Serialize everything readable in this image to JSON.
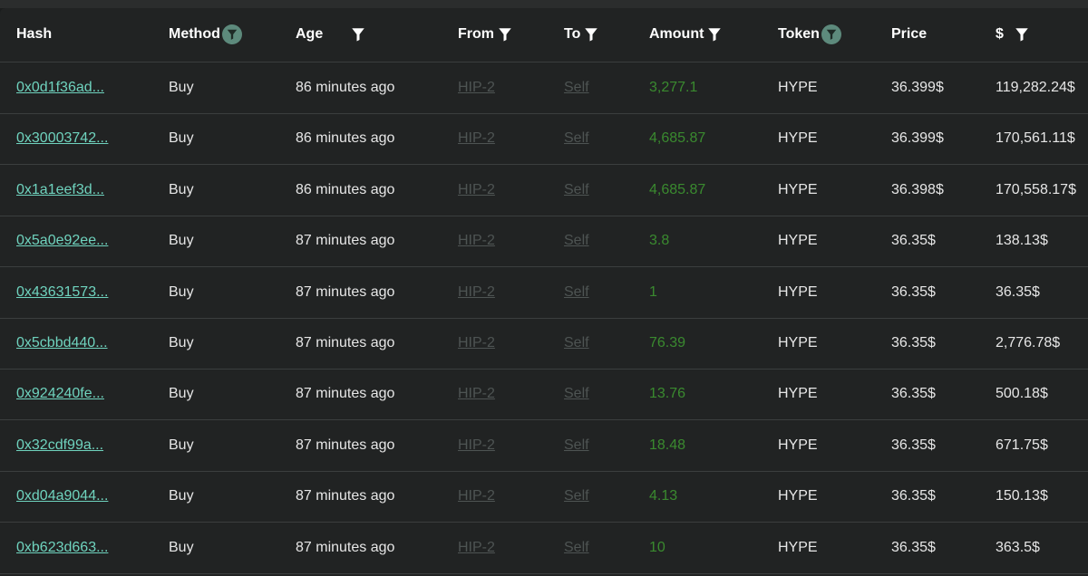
{
  "columns": [
    {
      "key": "hash",
      "label": "Hash",
      "filter": "none"
    },
    {
      "key": "method",
      "label": "Method",
      "filter": "active"
    },
    {
      "key": "age",
      "label": "Age",
      "filter": "plain"
    },
    {
      "key": "from",
      "label": "From",
      "filter": "plain"
    },
    {
      "key": "to",
      "label": "To",
      "filter": "plain"
    },
    {
      "key": "amount",
      "label": "Amount",
      "filter": "plain"
    },
    {
      "key": "token",
      "label": "Token",
      "filter": "active"
    },
    {
      "key": "price",
      "label": "Price",
      "filter": "none"
    },
    {
      "key": "usd",
      "label": "$",
      "filter": "plain"
    }
  ],
  "rows": [
    {
      "hash": "0x0d1f36ad...",
      "method": "Buy",
      "age": "86 minutes ago",
      "from": "HIP-2",
      "to": "Self",
      "amount": "3,277.1",
      "token": "HYPE",
      "price": "36.399$",
      "usd": "119,282.24$"
    },
    {
      "hash": "0x30003742...",
      "method": "Buy",
      "age": "86 minutes ago",
      "from": "HIP-2",
      "to": "Self",
      "amount": "4,685.87",
      "token": "HYPE",
      "price": "36.399$",
      "usd": "170,561.11$"
    },
    {
      "hash": "0x1a1eef3d...",
      "method": "Buy",
      "age": "86 minutes ago",
      "from": "HIP-2",
      "to": "Self",
      "amount": "4,685.87",
      "token": "HYPE",
      "price": "36.398$",
      "usd": "170,558.17$"
    },
    {
      "hash": "0x5a0e92ee...",
      "method": "Buy",
      "age": "87 minutes ago",
      "from": "HIP-2",
      "to": "Self",
      "amount": "3.8",
      "token": "HYPE",
      "price": "36.35$",
      "usd": "138.13$"
    },
    {
      "hash": "0x43631573...",
      "method": "Buy",
      "age": "87 minutes ago",
      "from": "HIP-2",
      "to": "Self",
      "amount": "1",
      "token": "HYPE",
      "price": "36.35$",
      "usd": "36.35$"
    },
    {
      "hash": "0x5cbbd440...",
      "method": "Buy",
      "age": "87 minutes ago",
      "from": "HIP-2",
      "to": "Self",
      "amount": "76.39",
      "token": "HYPE",
      "price": "36.35$",
      "usd": "2,776.78$"
    },
    {
      "hash": "0x924240fe...",
      "method": "Buy",
      "age": "87 minutes ago",
      "from": "HIP-2",
      "to": "Self",
      "amount": "13.76",
      "token": "HYPE",
      "price": "36.35$",
      "usd": "500.18$"
    },
    {
      "hash": "0x32cdf99a...",
      "method": "Buy",
      "age": "87 minutes ago",
      "from": "HIP-2",
      "to": "Self",
      "amount": "18.48",
      "token": "HYPE",
      "price": "36.35$",
      "usd": "671.75$"
    },
    {
      "hash": "0xd04a9044...",
      "method": "Buy",
      "age": "87 minutes ago",
      "from": "HIP-2",
      "to": "Self",
      "amount": "4.13",
      "token": "HYPE",
      "price": "36.35$",
      "usd": "150.13$"
    },
    {
      "hash": "0xb623d663...",
      "method": "Buy",
      "age": "87 minutes ago",
      "from": "HIP-2",
      "to": "Self",
      "amount": "10",
      "token": "HYPE",
      "price": "36.35$",
      "usd": "363.5$"
    }
  ],
  "colors": {
    "background": "#212323",
    "hash_link": "#6fd3be",
    "address_link": "#4e5453",
    "amount_positive": "#3a8a2f",
    "active_filter": "#5d8a7c"
  },
  "icons": {
    "filter": "funnel-filter-icon"
  }
}
